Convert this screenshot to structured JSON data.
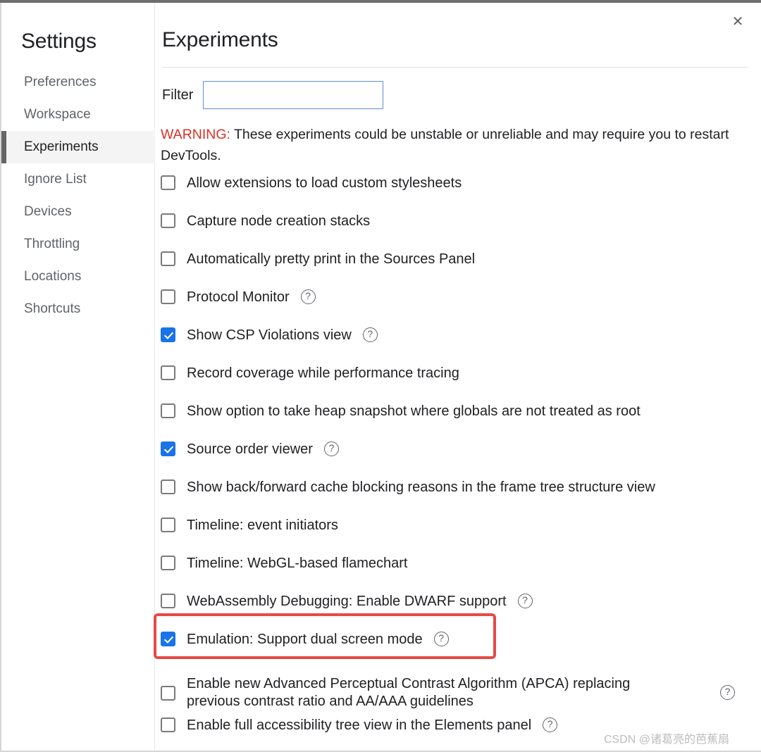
{
  "window": {
    "close_label": "✕"
  },
  "sidebar": {
    "title": "Settings",
    "items": [
      {
        "label": "Preferences",
        "selected": false
      },
      {
        "label": "Workspace",
        "selected": false
      },
      {
        "label": "Experiments",
        "selected": true
      },
      {
        "label": "Ignore List",
        "selected": false
      },
      {
        "label": "Devices",
        "selected": false
      },
      {
        "label": "Throttling",
        "selected": false
      },
      {
        "label": "Locations",
        "selected": false
      },
      {
        "label": "Shortcuts",
        "selected": false
      }
    ]
  },
  "main": {
    "title": "Experiments",
    "filter": {
      "label": "Filter",
      "value": "",
      "placeholder": ""
    },
    "warning": {
      "label": "WARNING:",
      "text": " These experiments could be unstable or unreliable and may require you to restart DevTools.",
      "color": "#d93025"
    },
    "experiments": [
      {
        "label": "Allow extensions to load custom stylesheets",
        "checked": false,
        "help": false,
        "help_far": false
      },
      {
        "label": "Capture node creation stacks",
        "checked": false,
        "help": false,
        "help_far": false
      },
      {
        "label": "Automatically pretty print in the Sources Panel",
        "checked": false,
        "help": false,
        "help_far": false
      },
      {
        "label": "Protocol Monitor",
        "checked": false,
        "help": true,
        "help_far": false
      },
      {
        "label": "Show CSP Violations view",
        "checked": true,
        "help": true,
        "help_far": false
      },
      {
        "label": "Record coverage while performance tracing",
        "checked": false,
        "help": false,
        "help_far": false
      },
      {
        "label": "Show option to take heap snapshot where globals are not treated as root",
        "checked": false,
        "help": false,
        "help_far": false
      },
      {
        "label": "Source order viewer",
        "checked": true,
        "help": true,
        "help_far": false
      },
      {
        "label": "Show back/forward cache blocking reasons in the frame tree structure view",
        "checked": false,
        "help": false,
        "help_far": false
      },
      {
        "label": "Timeline: event initiators",
        "checked": false,
        "help": false,
        "help_far": false
      },
      {
        "label": "Timeline: WebGL-based flamechart",
        "checked": false,
        "help": false,
        "help_far": false
      },
      {
        "label": "WebAssembly Debugging: Enable DWARF support",
        "checked": false,
        "help": true,
        "help_far": false
      },
      {
        "label": "Emulation: Support dual screen mode",
        "checked": true,
        "help": true,
        "help_far": false,
        "highlighted": true
      },
      {
        "label": "Enable new Advanced Perceptual Contrast Algorithm (APCA) replacing\nprevious contrast ratio and AA/AAA guidelines",
        "checked": false,
        "help": false,
        "help_far": true,
        "tall": true
      },
      {
        "label": "Enable full accessibility tree view in the Elements panel",
        "checked": false,
        "help": true,
        "help_far": false
      }
    ]
  },
  "annotation": {
    "highlight_color": "#e64a45"
  },
  "watermark": {
    "text": "CSDN @诸葛亮的芭蕉扇"
  },
  "icons": {
    "help": "?",
    "close": "✕"
  }
}
